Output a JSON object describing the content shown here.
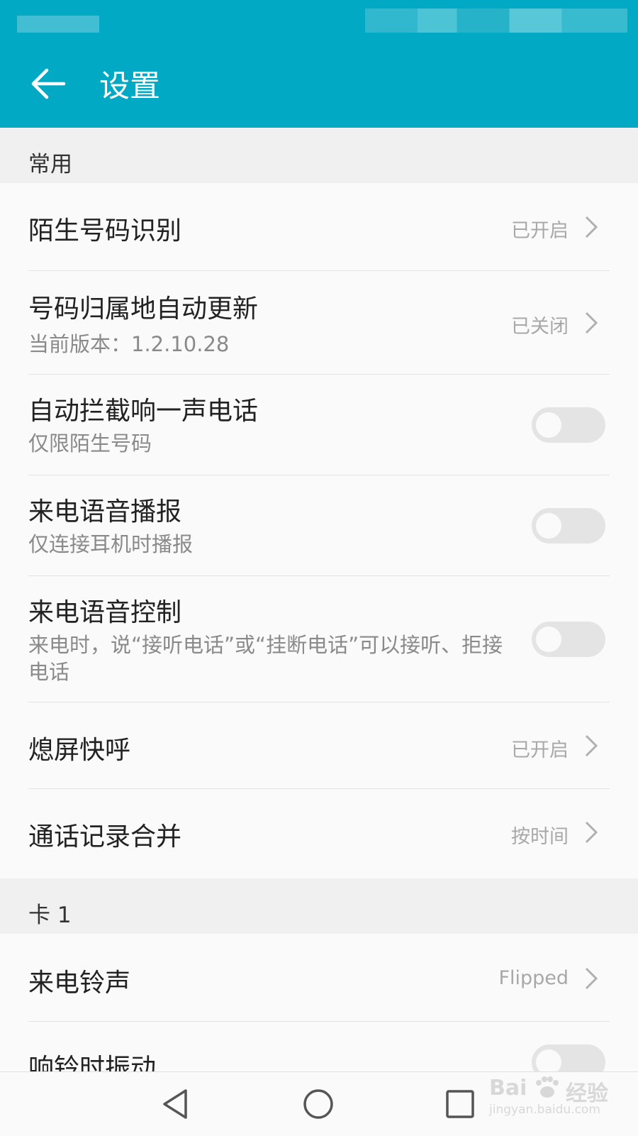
{
  "header": {
    "title": "设置"
  },
  "sections": [
    {
      "title": "常用"
    },
    {
      "title": "卡 1"
    }
  ],
  "rows": [
    {
      "label": "陌生号码识别",
      "value": "已开启"
    },
    {
      "label": "号码归属地自动更新",
      "sub": "当前版本：1.2.10.28",
      "value": "已关闭"
    },
    {
      "label": "自动拦截响一声电话",
      "sub": "仅限陌生号码",
      "toggle_on": false
    },
    {
      "label": "来电语音播报",
      "sub": "仅连接耳机时播报",
      "toggle_on": false
    },
    {
      "label": "来电语音控制",
      "sub": "来电时，说“接听电话”或“挂断电话”可以接听、拒接电话",
      "toggle_on": false
    },
    {
      "label": "熄屏快呼",
      "value": "已开启"
    },
    {
      "label": "通话记录合并",
      "value": "按时间"
    },
    {
      "label": "来电铃声",
      "value": "Flipped"
    },
    {
      "label": "响铃时振动",
      "toggle_on": false
    }
  ],
  "navbar": {
    "buttons": [
      "back-icon",
      "home-icon",
      "recents-icon"
    ]
  },
  "watermark": {
    "logo": "Bai",
    "logo_suffix": "经验",
    "url": "jingyan.baidu.com"
  },
  "colors": {
    "accent": "#02a9c4",
    "toggle_off": "#e4e4e4"
  }
}
